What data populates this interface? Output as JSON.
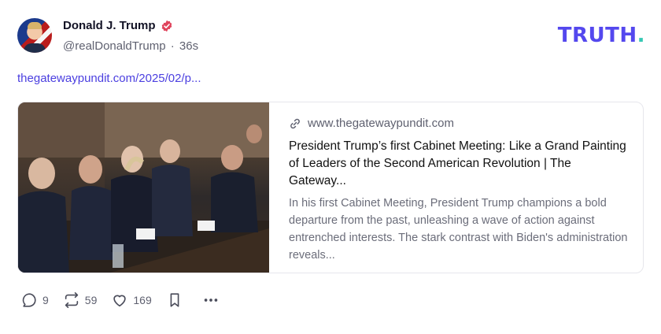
{
  "author": {
    "display_name": "Donald J. Trump",
    "handle": "@realDonaldTrump",
    "time": "36s",
    "separator": "·"
  },
  "brand": {
    "logo_main": "TRUTH",
    "logo_dot": "."
  },
  "post": {
    "link_text": "thegatewaypundit.com/2025/02/p..."
  },
  "card": {
    "domain": "www.thegatewaypundit.com",
    "title": "President Trump’s first Cabinet Meeting: Like a Grand Painting of Leaders of the Second American Revolution | The Gateway...",
    "description": "In his first Cabinet Meeting, President Trump champions a bold departure from the past, unleashing a wave of action against entrenched interests. The stark contrast with Biden's administration reveals..."
  },
  "actions": {
    "replies": "9",
    "retruths": "59",
    "likes": "169"
  },
  "colors": {
    "accent": "#5448ee",
    "logo_dot": "#36c8b4",
    "verified": "#e0445c",
    "link": "#4b3fe0"
  },
  "icons": [
    "verified-badge-icon",
    "link-icon",
    "reply-icon",
    "retruth-icon",
    "like-icon",
    "bookmark-icon",
    "more-icon"
  ]
}
